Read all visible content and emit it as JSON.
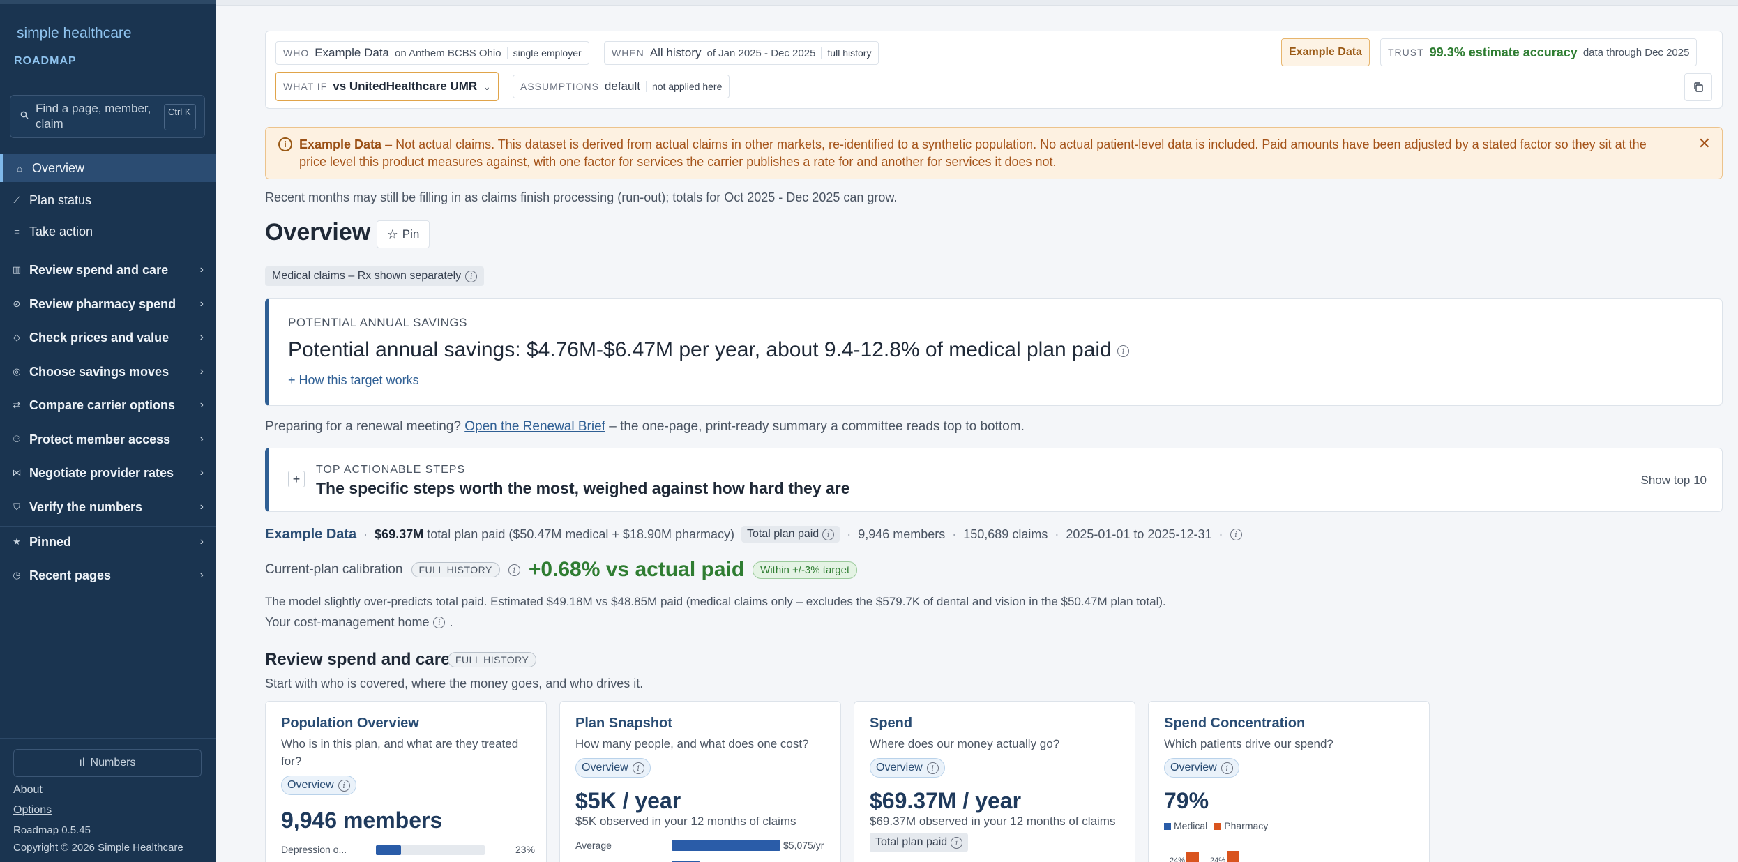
{
  "sidebar": {
    "brand": "simple healthcare",
    "product": "ROADMAP",
    "search_placeholder": "Find a page, member, claim",
    "search_shortcut": "Ctrl K",
    "items": [
      {
        "label": "Overview",
        "icon": "home-icon",
        "active": true
      },
      {
        "label": "Plan status",
        "icon": "trend-icon"
      },
      {
        "label": "Take action",
        "icon": "list-icon"
      },
      {
        "label": "Review spend and care",
        "icon": "bar-chart-icon"
      },
      {
        "label": "Review pharmacy spend",
        "icon": "pill-icon"
      },
      {
        "label": "Check prices and value",
        "icon": "tag-icon"
      },
      {
        "label": "Choose savings moves",
        "icon": "target-icon"
      },
      {
        "label": "Compare carrier options",
        "icon": "compare-icon"
      },
      {
        "label": "Protect member access",
        "icon": "people-icon"
      },
      {
        "label": "Negotiate provider rates",
        "icon": "handshake-icon"
      },
      {
        "label": "Verify the numbers",
        "icon": "shield-check-icon"
      },
      {
        "label": "Pinned",
        "icon": "star-icon"
      },
      {
        "label": "Recent pages",
        "icon": "clock-icon"
      }
    ],
    "numbers_button": "Numbers",
    "about": "About",
    "options": "Options",
    "version": "Roadmap 0.5.45",
    "copyright": "Copyright © 2026 Simple Healthcare"
  },
  "context": {
    "who_key": "WHO",
    "who_value": "Example Data",
    "who_sub": "on Anthem BCBS Ohio",
    "who_pill": "single employer",
    "when_key": "WHEN",
    "when_value": "All history",
    "when_sub": "of Jan 2025 - Dec 2025",
    "when_pill": "full history",
    "whatif_key": "WHAT IF",
    "whatif_value": "vs UnitedHealthcare UMR",
    "assumptions_key": "ASSUMPTIONS",
    "assumptions_value": "default",
    "assumptions_pill": "not applied here",
    "example_badge": "Example Data",
    "trust_key": "TRUST",
    "trust_value": "99.3% estimate accuracy",
    "trust_sub": "data through Dec 2025"
  },
  "alert": {
    "bold": "Example Data",
    "text": " – Not actual claims. This dataset is derived from actual claims in other markets, re-identified to a synthetic population. No actual patient-level data is included. Paid amounts have been adjusted by a stated factor so they sit at the price level this product measures against, with one factor for services the carrier publishes a rate for and another for services it does not."
  },
  "runout_note": "Recent months may still be filling in as claims finish processing (run-out); totals for Oct 2025 - Dec 2025 can grow.",
  "page": {
    "title": "Overview",
    "pin_label": "Pin",
    "scope_chip": "Medical claims – Rx shown separately"
  },
  "savings": {
    "eyebrow": "POTENTIAL ANNUAL SAVINGS",
    "headline": "Potential annual savings: $4.76M-$6.47M per year, about 9.4-12.8% of medical plan paid",
    "link": "+ How this target works"
  },
  "renewal": {
    "prefix": "Preparing for a renewal meeting? ",
    "link": "Open the Renewal Brief",
    "suffix": " – the one-page, print-ready summary a committee reads top to bottom."
  },
  "steps": {
    "eyebrow": "TOP ACTIONABLE STEPS",
    "title": "The specific steps worth the most, weighed against how hard they are",
    "show": "Show top 10"
  },
  "summary": {
    "name": "Example Data",
    "total": "$69.37M",
    "total_rest": "total plan paid ($50.47M medical + $18.90M pharmacy)",
    "chip": "Total plan paid",
    "members": "9,946 members",
    "claims": "150,689 claims",
    "range": "2025-01-01 to 2025-12-31"
  },
  "calibration": {
    "label": "Current-plan calibration",
    "badge": "FULL HISTORY",
    "value": "+0.68% vs actual paid",
    "target": "Within +/-3% target",
    "desc": "The model slightly over-predicts total paid. Estimated $49.18M vs $48.85M paid (medical claims only – excludes the $579.7K of dental and vision in the $50.47M plan total).",
    "home": "Your cost-management home"
  },
  "section": {
    "title": "Review spend and care",
    "badge": "FULL HISTORY",
    "subtitle": "Start with who is covered, where the money goes, and who drives it."
  },
  "tiles": [
    {
      "title": "Population Overview",
      "question": "Who is in this plan, and what are they treated for?",
      "badge": "Overview",
      "metric": "9,946 members",
      "row_label": "Depression o...",
      "row_pct": "23%"
    },
    {
      "title": "Plan Snapshot",
      "question": "How many people, and what does one cost?",
      "badge": "Overview",
      "metric": "$5K / year",
      "sub": "$5K observed in your 12 months of claims",
      "row_label": "Average",
      "row_value": "$5,075/yr"
    },
    {
      "title": "Spend",
      "question": "Where does our money actually go?",
      "badge": "Overview",
      "metric": "$69.37M / year",
      "sub": "$69.37M observed in your 12 months of claims",
      "chip": "Total plan paid"
    },
    {
      "title": "Spend Concentration",
      "question": "Which patients drive our spend?",
      "badge": "Overview",
      "metric": "79%",
      "legend": [
        "Medical",
        "Pharmacy"
      ],
      "bar_label_1": "24%",
      "bar_label_2": "24%"
    }
  ],
  "colors": {
    "sidebar_bg": "#1a3450",
    "accent": "#2f5f94",
    "success": "#2f7d32",
    "warning": "#a5541a",
    "medical": "#2a5ca8",
    "pharmacy": "#d9541e"
  }
}
